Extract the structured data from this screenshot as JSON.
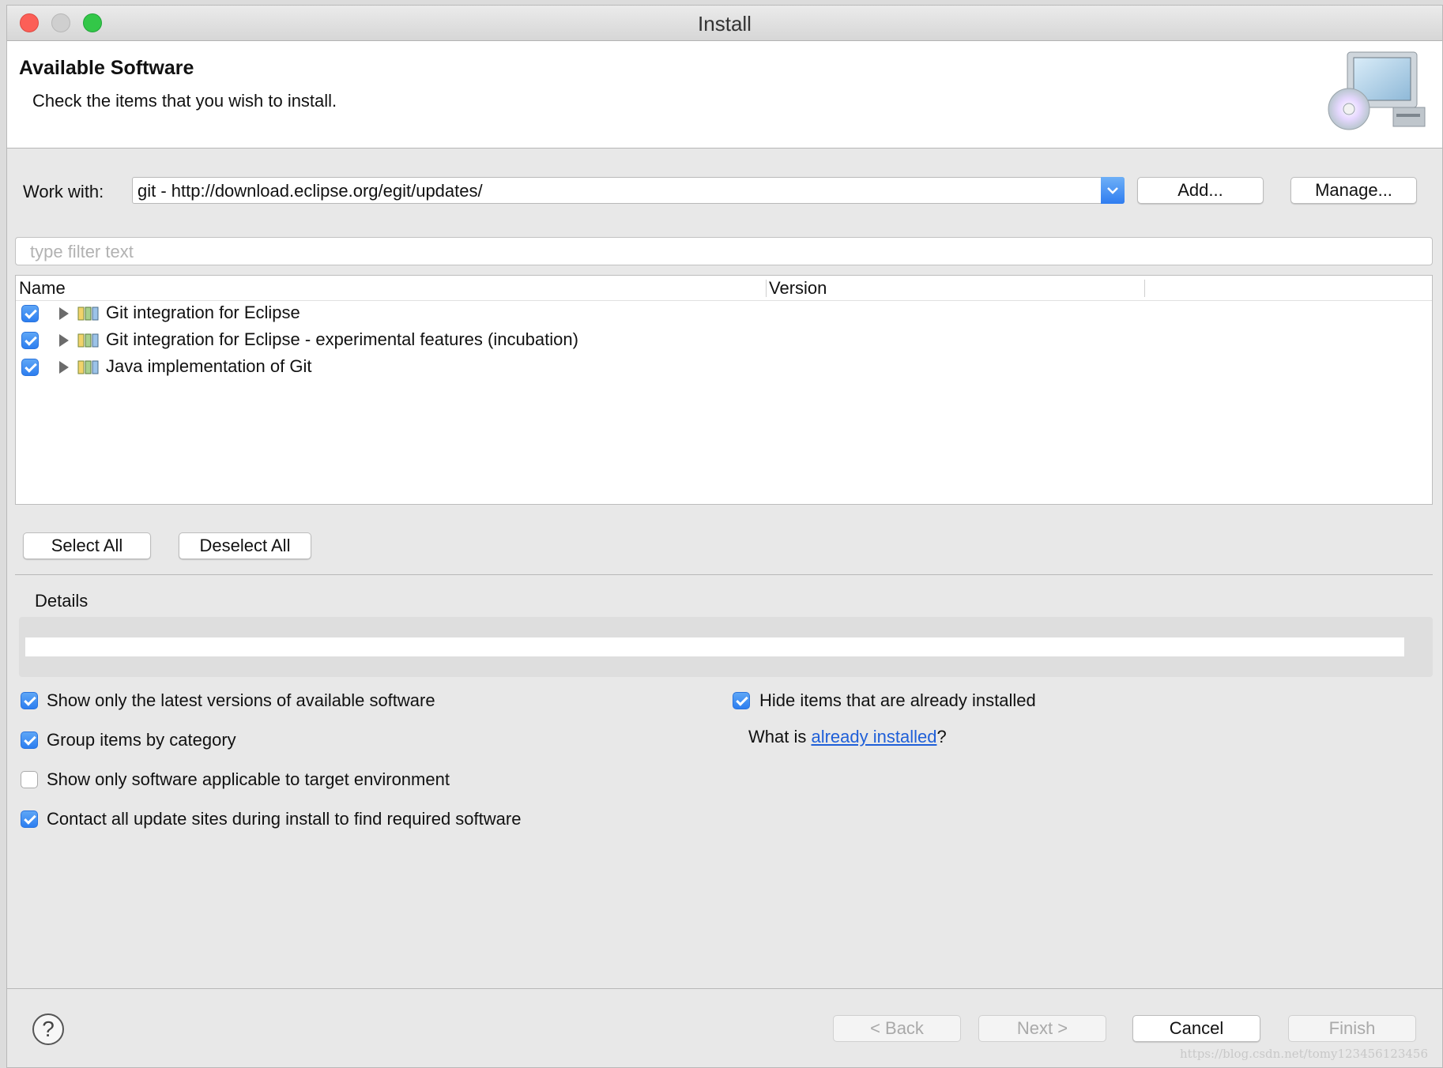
{
  "window": {
    "title": "Install"
  },
  "header": {
    "title": "Available Software",
    "subtitle": "Check the items that you wish to install.",
    "icon": "install-software-icon"
  },
  "work_with": {
    "label": "Work with:",
    "value": "git - http://download.eclipse.org/egit/updates/",
    "add_label": "Add...",
    "manage_label": "Manage..."
  },
  "filter": {
    "placeholder": "type filter text"
  },
  "tree": {
    "columns": [
      "Name",
      "Version"
    ],
    "rows": [
      {
        "checked": true,
        "label": "Git integration for Eclipse",
        "version": ""
      },
      {
        "checked": true,
        "label": "Git integration for Eclipse - experimental features  (incubation)",
        "version": ""
      },
      {
        "checked": true,
        "label": "Java implementation of Git",
        "version": ""
      }
    ]
  },
  "selection": {
    "select_all": "Select All",
    "deselect_all": "Deselect All"
  },
  "details": {
    "label": "Details",
    "value": ""
  },
  "options": {
    "latest_versions": {
      "checked": true,
      "label": "Show only the latest versions of available software"
    },
    "group_by_category": {
      "checked": true,
      "label": "Group items by category"
    },
    "applicable_only": {
      "checked": false,
      "label": "Show only software applicable to target environment"
    },
    "contact_sites": {
      "checked": true,
      "label": "Contact all update sites during install to find required software"
    },
    "hide_installed": {
      "checked": true,
      "label": "Hide items that are already installed"
    }
  },
  "already_installed": {
    "prefix": "What is ",
    "link": "already installed",
    "suffix": "?"
  },
  "footer": {
    "help": "?",
    "back": "< Back",
    "next": "Next >",
    "cancel": "Cancel",
    "finish": "Finish"
  },
  "watermark": "https://blog.csdn.net/tomy123456123456",
  "colors": {
    "accent": "#2c7ef0",
    "link": "#1f5fd8",
    "window_bg": "#e8e8e8"
  }
}
